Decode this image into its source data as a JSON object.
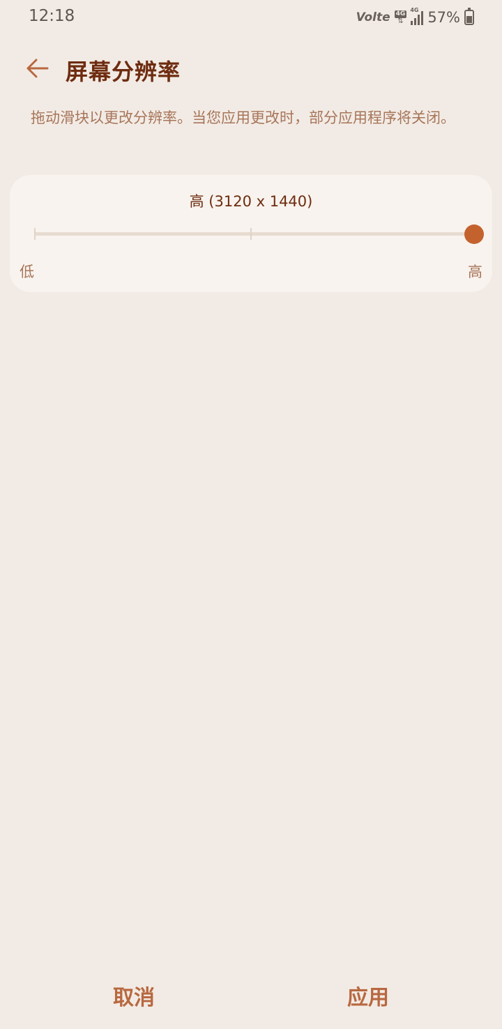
{
  "status_bar": {
    "time": "12:18",
    "volte": "Volte",
    "network": "4G",
    "signal_label": "4G",
    "battery_percent": "57%",
    "battery_icon": "battery-charging-icon"
  },
  "header": {
    "back_icon": "arrow-left-icon",
    "title": "屏幕分辨率"
  },
  "description": "拖动滑块以更改分辨率。当您应用更改时，部分应用程序将关闭。",
  "resolution": {
    "current_label": "高 (3120 x 1440)",
    "low_label": "低",
    "high_label": "高",
    "levels": 3,
    "selected_level": 2
  },
  "actions": {
    "cancel": "取消",
    "apply": "应用"
  },
  "colors": {
    "background": "#f2ebe5",
    "card": "#f8f3ee",
    "accent": "#c4622e",
    "title": "#6e2c10",
    "muted_text": "#a77559"
  }
}
